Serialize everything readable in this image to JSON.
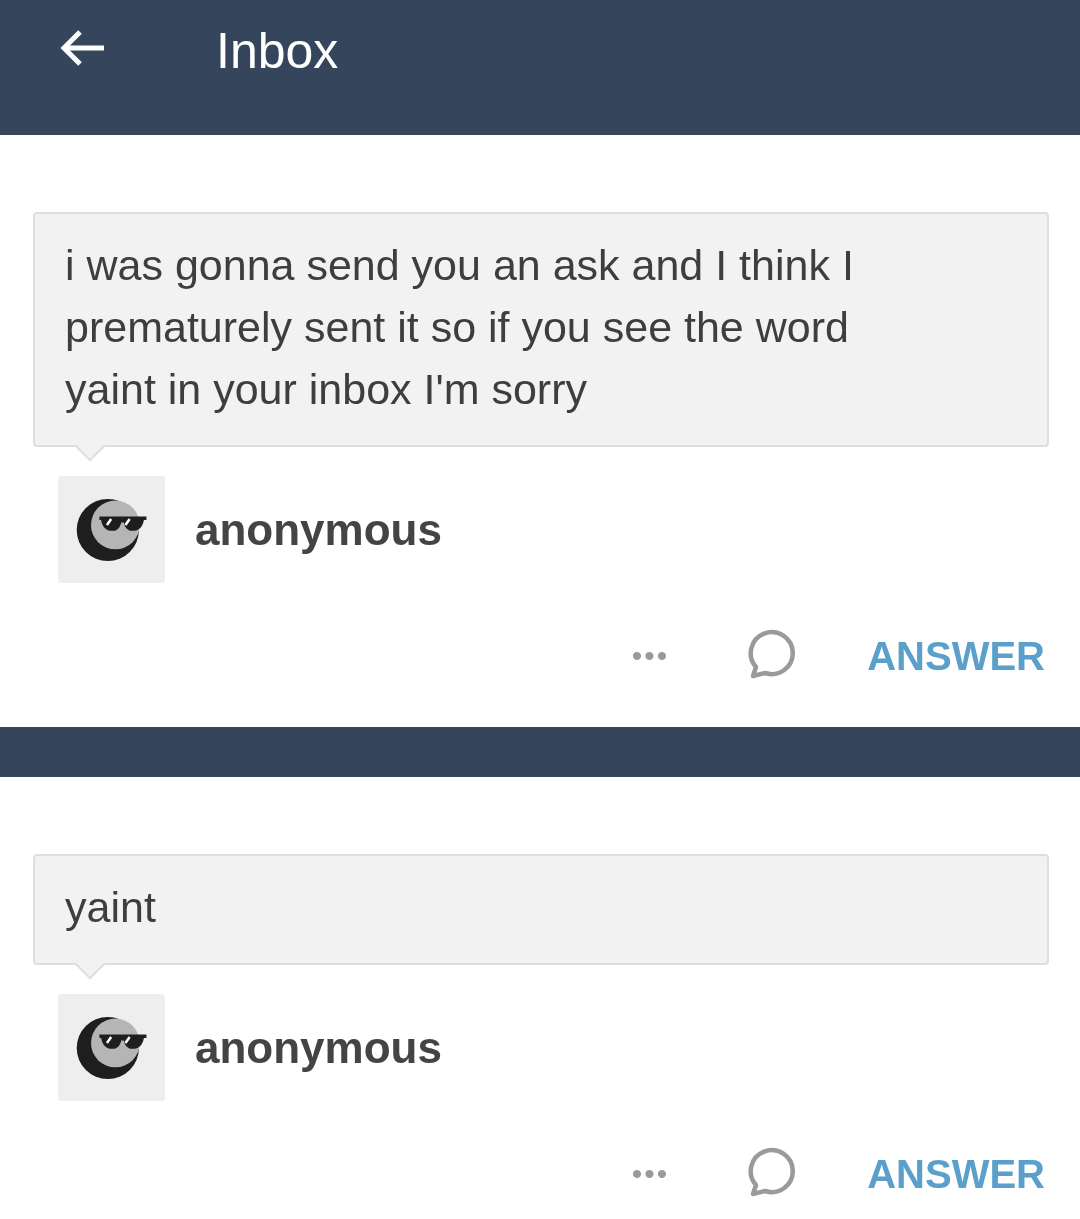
{
  "header": {
    "title": "Inbox"
  },
  "messages": [
    {
      "text": "i was gonna send you an ask and I think I prematurely sent it so if you see the word yaint in your inbox I'm sorry",
      "sender": "anonymous",
      "more": "•••",
      "action": "ANSWER"
    },
    {
      "text": "yaint",
      "sender": "anonymous",
      "more": "•••",
      "action": "ANSWER"
    }
  ]
}
